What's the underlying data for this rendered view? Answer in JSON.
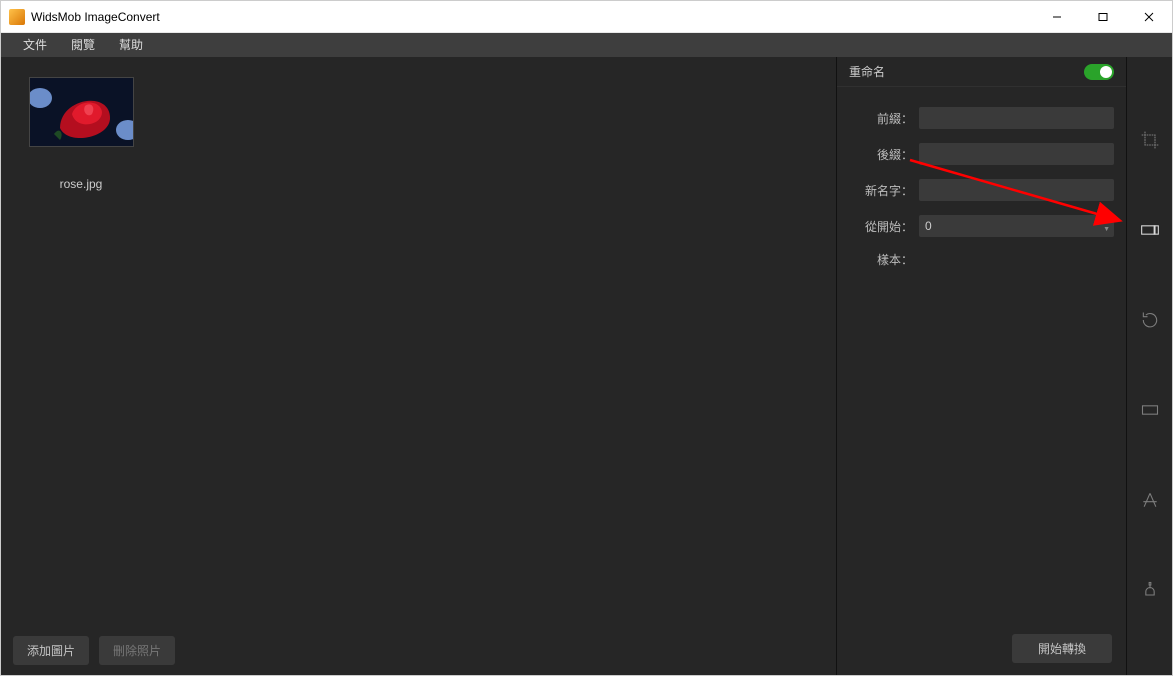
{
  "titlebar": {
    "title": "WidsMob ImageConvert"
  },
  "menubar": {
    "file": "文件",
    "view": "閱覽",
    "help": "幫助"
  },
  "thumb": {
    "filename": "rose.jpg"
  },
  "footer": {
    "add": "添加圖片",
    "delete": "刪除照片",
    "convert": "開始轉換"
  },
  "panel": {
    "title": "重命名",
    "prefix_label": "前綴：",
    "suffix_label": "後綴：",
    "newname_label": "新名字：",
    "start_label": "從開始：",
    "start_value": "0",
    "sample_label": "樣本："
  }
}
